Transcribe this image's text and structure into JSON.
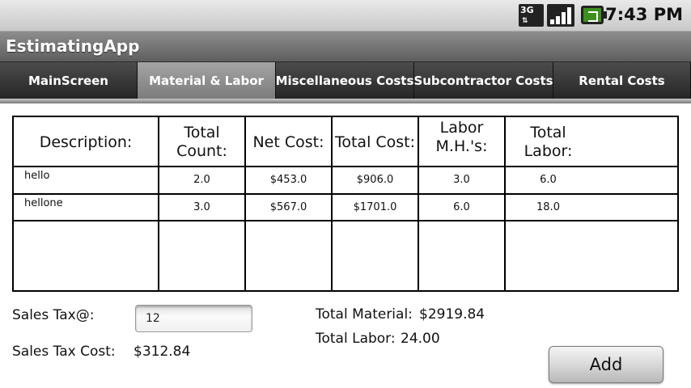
{
  "status_bar": {
    "network_label": "3G",
    "time": "7:43 PM",
    "icons": [
      "3g-data-icon",
      "signal-strength-icon",
      "battery-charging-icon"
    ]
  },
  "app": {
    "title": "EstimatingApp"
  },
  "tabs": [
    {
      "label": "MainScreen",
      "active": false
    },
    {
      "label": "Material & Labor",
      "active": true
    },
    {
      "label": "Miscellaneous Costs",
      "active": false
    },
    {
      "label": "Subcontractor Costs",
      "active": false
    },
    {
      "label": "Rental Costs",
      "active": false
    }
  ],
  "table": {
    "headers": [
      "Description:",
      "Total Count:",
      "Net Cost:",
      "Total Cost:",
      "Labor M.H.'s:",
      "Total Labor:"
    ],
    "rows": [
      {
        "description": "hello",
        "total_count": "2.0",
        "net_cost": "$453.0",
        "total_cost": "$906.0",
        "labor_mh": "3.0",
        "total_labor": "6.0"
      },
      {
        "description": "hellone",
        "total_count": "3.0",
        "net_cost": "$567.0",
        "total_cost": "$1701.0",
        "labor_mh": "6.0",
        "total_labor": "18.0"
      }
    ]
  },
  "summary": {
    "sales_tax_label": "Sales Tax@:",
    "sales_tax_value": "12",
    "sales_tax_cost_label": "Sales Tax Cost:",
    "sales_tax_cost_value": "$312.84",
    "total_material_label": "Total Material:",
    "total_material_value": "$2919.84",
    "total_labor_label": "Total Labor:",
    "total_labor_value": "24.00"
  },
  "buttons": {
    "add_label": "Add"
  }
}
